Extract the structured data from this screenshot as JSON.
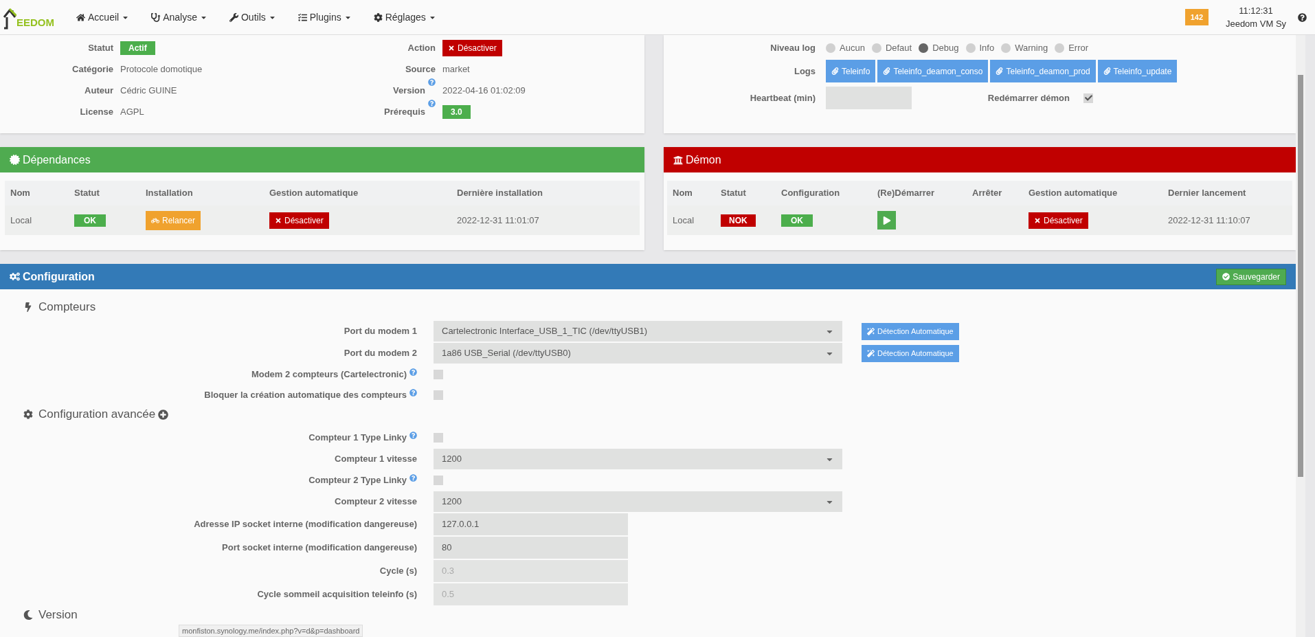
{
  "navbar": {
    "logo": "EEDOM",
    "menus": [
      {
        "label": "Accueil"
      },
      {
        "label": "Analyse"
      },
      {
        "label": "Outils"
      },
      {
        "label": "Plugins"
      },
      {
        "label": "Réglages"
      }
    ],
    "badge": "142",
    "time": "11:12:31",
    "system": "Jeedom VM Sy"
  },
  "info": {
    "left": [
      {
        "label": "Statut",
        "kind": "badge",
        "value": "Actif",
        "color": "#4cae4c"
      },
      {
        "label": "Catégorie",
        "kind": "text",
        "value": "Protocole domotique"
      },
      {
        "label": "Auteur",
        "kind": "text",
        "value": "Cédric GUINE"
      },
      {
        "label": "License",
        "kind": "text",
        "value": "AGPL"
      }
    ],
    "right": [
      {
        "label": "Action",
        "kind": "button",
        "value": "Désactiver",
        "help": false
      },
      {
        "label": "Source",
        "kind": "text",
        "value": "market",
        "help": false
      },
      {
        "label": "Version",
        "kind": "text",
        "value": "2022-04-16 01:02:09",
        "help": true
      },
      {
        "label": "Prérequis",
        "kind": "badge",
        "value": "3.0",
        "color": "#4cae4c",
        "help": true
      }
    ]
  },
  "log": {
    "label": "Niveau log",
    "levels": [
      {
        "label": "Aucun",
        "selected": false
      },
      {
        "label": "Defaut",
        "selected": false
      },
      {
        "label": "Debug",
        "selected": true
      },
      {
        "label": "Info",
        "selected": false
      },
      {
        "label": "Warning",
        "selected": false
      },
      {
        "label": "Error",
        "selected": false
      }
    ],
    "logs_label": "Logs",
    "logs": [
      "Teleinfo",
      "Teleinfo_deamon_conso",
      "Teleinfo_deamon_prod",
      "Teleinfo_update"
    ],
    "heartbeat_label": "Heartbeat (min)",
    "restart_label": "Redémarrer démon",
    "restart_checked": true
  },
  "dependances": {
    "title": "Dépendances",
    "columns": [
      "Nom",
      "Statut",
      "Installation",
      "Gestion automatique",
      "Dernière installation"
    ],
    "row": {
      "name": "Local",
      "status": {
        "text": "OK",
        "color": "#4cae4c"
      },
      "install": "Relancer",
      "auto": "Désactiver",
      "date": "2022-12-31 11:01:07"
    }
  },
  "demon": {
    "title": "Démon",
    "columns": [
      "Nom",
      "Statut",
      "Configuration",
      "(Re)Démarrer",
      "Arrêter",
      "Gestion automatique",
      "Dernier lancement"
    ],
    "row": {
      "name": "Local",
      "status": {
        "text": "NOK",
        "color": "#c00000"
      },
      "config": {
        "text": "OK",
        "color": "#4cae4c"
      },
      "auto": "Désactiver",
      "date": "2022-12-31 11:10:07"
    }
  },
  "configuration": {
    "title": "Configuration",
    "save": "Sauvegarder",
    "sections": [
      {
        "title": "Compteurs",
        "expand": false,
        "rows": [
          {
            "kind": "select",
            "label": "Port du modem 1",
            "help": false,
            "value": "Cartelectronic Interface_USB_1_TIC (/dev/ttyUSB1)",
            "action": "Détection Automatique"
          },
          {
            "kind": "select",
            "label": "Port du modem 2",
            "help": false,
            "value": "1a86 USB_Serial (/dev/ttyUSB0)",
            "action": "Détection Automatique"
          },
          {
            "kind": "checkbox",
            "label": "Modem 2 compteurs (Cartelectronic)",
            "help": true,
            "checked": false
          },
          {
            "kind": "checkbox",
            "label": "Bloquer la création automatique des compteurs",
            "help": true,
            "checked": false
          }
        ]
      },
      {
        "title": "Configuration avancée",
        "expand": true,
        "rows": [
          {
            "kind": "checkbox",
            "label": "Compteur 1 Type Linky",
            "help": true,
            "checked": false
          },
          {
            "kind": "select",
            "label": "Compteur 1 vitesse",
            "help": false,
            "value": "1200"
          },
          {
            "kind": "checkbox",
            "label": "Compteur 2 Type Linky",
            "help": true,
            "checked": false
          },
          {
            "kind": "select",
            "label": "Compteur 2 vitesse",
            "help": false,
            "value": "1200"
          },
          {
            "kind": "input",
            "label": "Adresse IP socket interne (modification dangereuse)",
            "help": false,
            "value": "127.0.0.1",
            "disabled": false
          },
          {
            "kind": "input",
            "label": "Port socket interne (modification dangereuse)",
            "help": false,
            "value": "80",
            "disabled": false
          },
          {
            "kind": "input",
            "label": "Cycle (s)",
            "help": false,
            "placeholder": "0.3",
            "disabled": true
          },
          {
            "kind": "input",
            "label": "Cycle sommeil acquisition teleinfo (s)",
            "help": false,
            "placeholder": "0.5",
            "disabled": true
          }
        ]
      },
      {
        "title": "Version",
        "expand": false
      }
    ]
  },
  "status_url": "monfiston.synology.me/index.php?v=d&p=dashboard"
}
